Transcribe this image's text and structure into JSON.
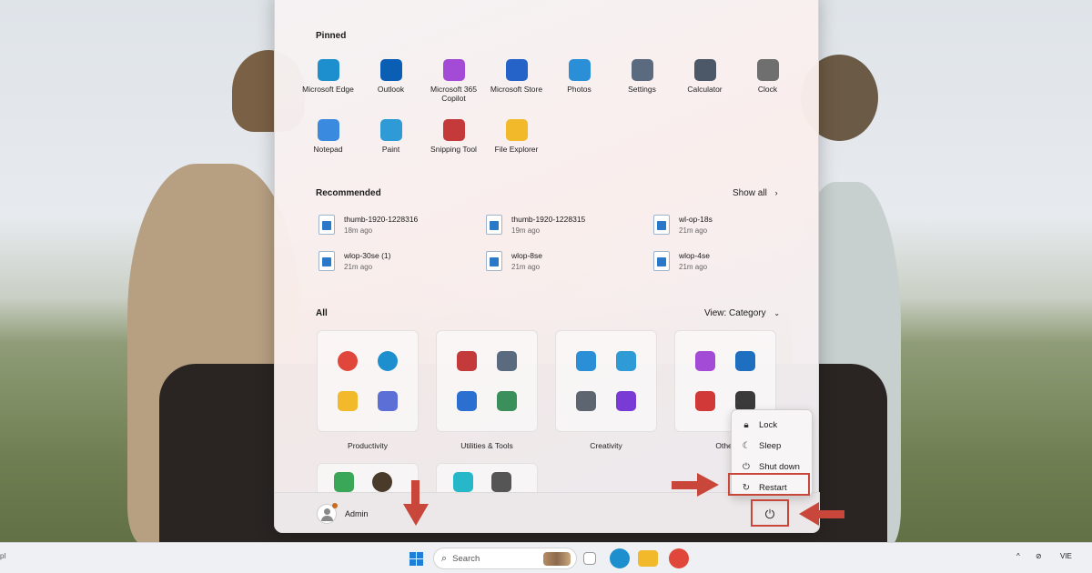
{
  "start_menu": {
    "pinned_title": "Pinned",
    "pinned_apps": [
      {
        "label": "Microsoft Edge",
        "icon": "edge-icon",
        "color": "#1d8fce"
      },
      {
        "label": "Outlook",
        "icon": "outlook-icon",
        "color": "#0a5fb4"
      },
      {
        "label": "Microsoft 365\nCopilot",
        "icon": "m365-copilot-icon",
        "color": "#a34ad6"
      },
      {
        "label": "Microsoft Store",
        "icon": "store-icon",
        "color": "#2563c9"
      },
      {
        "label": "Photos",
        "icon": "photos-icon",
        "color": "#2b8fd8"
      },
      {
        "label": "Settings",
        "icon": "settings-icon",
        "color": "#5a6b80"
      },
      {
        "label": "Calculator",
        "icon": "calculator-icon",
        "color": "#4c5867"
      },
      {
        "label": "Clock",
        "icon": "clock-icon",
        "color": "#6f6f6f"
      },
      {
        "label": "Notepad",
        "icon": "notepad-icon",
        "color": "#3a8be0"
      },
      {
        "label": "Paint",
        "icon": "paint-icon",
        "color": "#2e9bd6"
      },
      {
        "label": "Snipping Tool",
        "icon": "snipping-tool-icon",
        "color": "#c43a3a"
      },
      {
        "label": "File Explorer",
        "icon": "file-explorer-icon",
        "color": "#f2b92b"
      }
    ],
    "recommended_title": "Recommended",
    "show_all": "Show all",
    "recommended": [
      {
        "name": "thumb-1920-1228316",
        "time": "18m ago"
      },
      {
        "name": "thumb-1920-1228315",
        "time": "19m ago"
      },
      {
        "name": "wl-op-18s",
        "time": "21m ago"
      },
      {
        "name": "wlop-30se (1)",
        "time": "21m ago"
      },
      {
        "name": "wlop-8se",
        "time": "21m ago"
      },
      {
        "name": "wlop-4se",
        "time": "21m ago"
      }
    ],
    "all_title": "All",
    "view_label": "View: Category",
    "categories": [
      {
        "label": "Productivity",
        "icons": [
          "chrome-icon",
          "edge-icon",
          "file-explorer-icon",
          "office-tools-icon"
        ],
        "colors": [
          "#e0463a",
          "#1d8fce",
          "#f2b92b",
          "#5b6fd6"
        ]
      },
      {
        "label": "Utilities & Tools",
        "icons": [
          "snipping-tool-icon",
          "settings-icon",
          "feedback-icon",
          "task-manager-icon"
        ],
        "colors": [
          "#c43a3a",
          "#5a6b80",
          "#2b6fd1",
          "#3b8f5a"
        ]
      },
      {
        "label": "Creativity",
        "icons": [
          "photos-icon",
          "paint-icon",
          "camera-icon",
          "clipchamp-icon"
        ],
        "colors": [
          "#2b8fd8",
          "#2e9bd6",
          "#5d6670",
          "#7a3ad6"
        ]
      },
      {
        "label": "Other",
        "icons": [
          "copilot-icon",
          "azure-icon",
          "news-icon",
          "terminal-icon"
        ],
        "colors": [
          "#a34ad6",
          "#1f6fc1",
          "#d13838",
          "#3a3a3a"
        ]
      }
    ],
    "user_name": "Admin",
    "power_menu": [
      {
        "label": "Lock",
        "icon": "lock-icon"
      },
      {
        "label": "Sleep",
        "icon": "sleep-icon"
      },
      {
        "label": "Shut down",
        "icon": "power-icon"
      },
      {
        "label": "Restart",
        "icon": "restart-icon"
      }
    ]
  },
  "taskbar": {
    "search_placeholder": "Search",
    "left_fragment": "pl",
    "language": "VIE",
    "tray_chevron": "^"
  },
  "annotation_color": "#c9473a"
}
